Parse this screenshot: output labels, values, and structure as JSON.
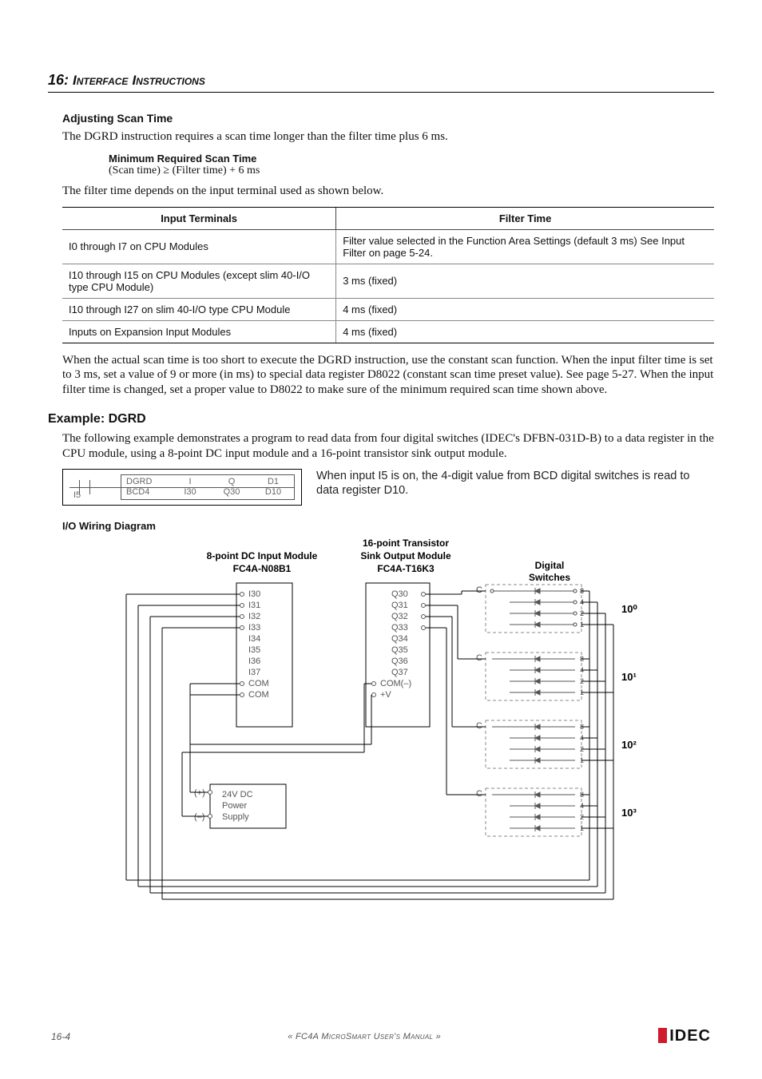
{
  "chapter": {
    "num": "16:",
    "title_a": "Interface",
    "title_b": "Instructions"
  },
  "adjusting": {
    "heading": "Adjusting Scan Time",
    "p1": "The DGRD instruction requires a scan time longer than the filter time plus 6 ms.",
    "sub": "Minimum Required Scan Time",
    "formula": "(Scan time) ≥ (Filter time) + 6 ms",
    "p2": "The filter time depends on the input terminal used as shown below."
  },
  "filter_table": {
    "headers": [
      "Input Terminals",
      "Filter Time"
    ],
    "rows": [
      [
        "I0 through I7 on CPU Modules",
        "Filter value selected in the Function Area Settings (default 3 ms) See Input Filter on page 5-24."
      ],
      [
        "I10 through I15 on CPU Modules (except slim 40-I/O type CPU Module)",
        "3 ms (fixed)"
      ],
      [
        "I10 through I27 on slim 40-I/O type CPU Module",
        "4 ms (fixed)"
      ],
      [
        "Inputs on Expansion Input Modules",
        "4 ms (fixed)"
      ]
    ]
  },
  "after_table_p": "When the actual scan time is too short to execute the DGRD instruction, use the constant scan function. When the input filter time is set to 3 ms, set a value of 9 or more (in ms) to special data register D8022 (constant scan time preset value). See page 5-27. When the input filter time is changed, set a proper value to D8022 to make sure of the minimum required scan time shown above.",
  "example": {
    "heading": "Example: DGRD",
    "p": "The following example demonstrates a program to read data from four digital switches (IDEC's DFBN-031D-B) to a data register in the CPU module, using a 8-point DC input module and a 16-point transistor sink output module.",
    "ladder": {
      "contact": "I5",
      "name": "DGRD",
      "sub": "BCD4",
      "col_i_h": "I",
      "col_i_v": "I30",
      "col_q_h": "Q",
      "col_q_v": "Q30",
      "col_d_h": "D1",
      "col_d_v": "D10"
    },
    "desc": "When input I5 is on, the 4-digit value from BCD digital switches is read to data register D10."
  },
  "io_heading": "I/O Wiring Diagram",
  "diagram": {
    "input_mod": {
      "l1": "8-point DC Input Module",
      "l2": "FC4A-N08B1",
      "terms": [
        "I30",
        "I31",
        "I32",
        "I33",
        "I34",
        "I35",
        "I36",
        "I37",
        "COM",
        "COM"
      ]
    },
    "output_mod": {
      "l1": "16-point Transistor",
      "l2": "Sink Output Module",
      "l3": "FC4A-T16K3",
      "terms": [
        "Q30",
        "Q31",
        "Q32",
        "Q33",
        "Q34",
        "Q35",
        "Q36",
        "Q37",
        "COM(–)",
        "+V"
      ]
    },
    "ds_label1": "Digital",
    "ds_label2": "Switches",
    "bits": [
      "8",
      "4",
      "2",
      "1"
    ],
    "exps": [
      "10⁰",
      "10¹",
      "10²",
      "10³"
    ],
    "c_label": "C",
    "ps": {
      "plus": "(+)",
      "minus": "(–)",
      "l1": "24V DC",
      "l2": "Power",
      "l3": "Supply"
    }
  },
  "footer": {
    "page": "16-4",
    "manual": "« FC4A MicroSmart User's Manual »",
    "logo": "IDEC"
  }
}
